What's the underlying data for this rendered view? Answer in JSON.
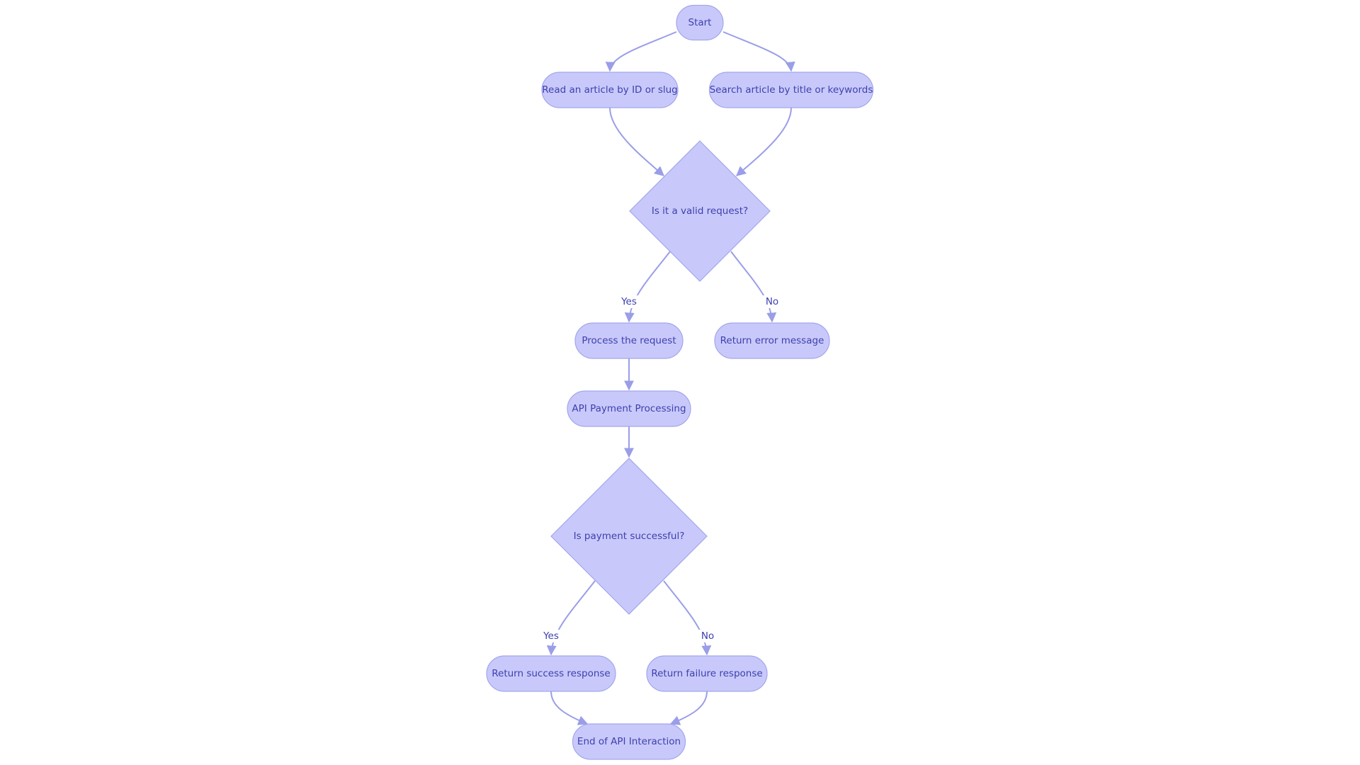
{
  "colors": {
    "node_fill": "#c8c9fa",
    "node_stroke": "#a3a6ec",
    "edge": "#9a9ee8",
    "text": "#3d3fae"
  },
  "nodes": [
    {
      "id": "start",
      "shape": "rounded",
      "label": "Start"
    },
    {
      "id": "read",
      "shape": "rounded",
      "label": "Read an article by ID or slug"
    },
    {
      "id": "search",
      "shape": "rounded",
      "label": "Search article by title or keywords"
    },
    {
      "id": "valid",
      "shape": "diamond",
      "label": "Is it a valid request?"
    },
    {
      "id": "process",
      "shape": "rounded",
      "label": "Process the request"
    },
    {
      "id": "error",
      "shape": "rounded",
      "label": "Return error message"
    },
    {
      "id": "payment",
      "shape": "rounded",
      "label": "API Payment Processing"
    },
    {
      "id": "paid",
      "shape": "diamond",
      "label": "Is payment successful?"
    },
    {
      "id": "success",
      "shape": "rounded",
      "label": "Return success response"
    },
    {
      "id": "failure",
      "shape": "rounded",
      "label": "Return failure response"
    },
    {
      "id": "end",
      "shape": "rounded",
      "label": "End of API Interaction"
    }
  ],
  "edges": [
    {
      "from": "start",
      "to": "read",
      "label": ""
    },
    {
      "from": "start",
      "to": "search",
      "label": ""
    },
    {
      "from": "read",
      "to": "valid",
      "label": ""
    },
    {
      "from": "search",
      "to": "valid",
      "label": ""
    },
    {
      "from": "valid",
      "to": "process",
      "label": "Yes"
    },
    {
      "from": "valid",
      "to": "error",
      "label": "No"
    },
    {
      "from": "process",
      "to": "payment",
      "label": ""
    },
    {
      "from": "payment",
      "to": "paid",
      "label": ""
    },
    {
      "from": "paid",
      "to": "success",
      "label": "Yes"
    },
    {
      "from": "paid",
      "to": "failure",
      "label": "No"
    },
    {
      "from": "success",
      "to": "end",
      "label": ""
    },
    {
      "from": "failure",
      "to": "end",
      "label": ""
    }
  ]
}
